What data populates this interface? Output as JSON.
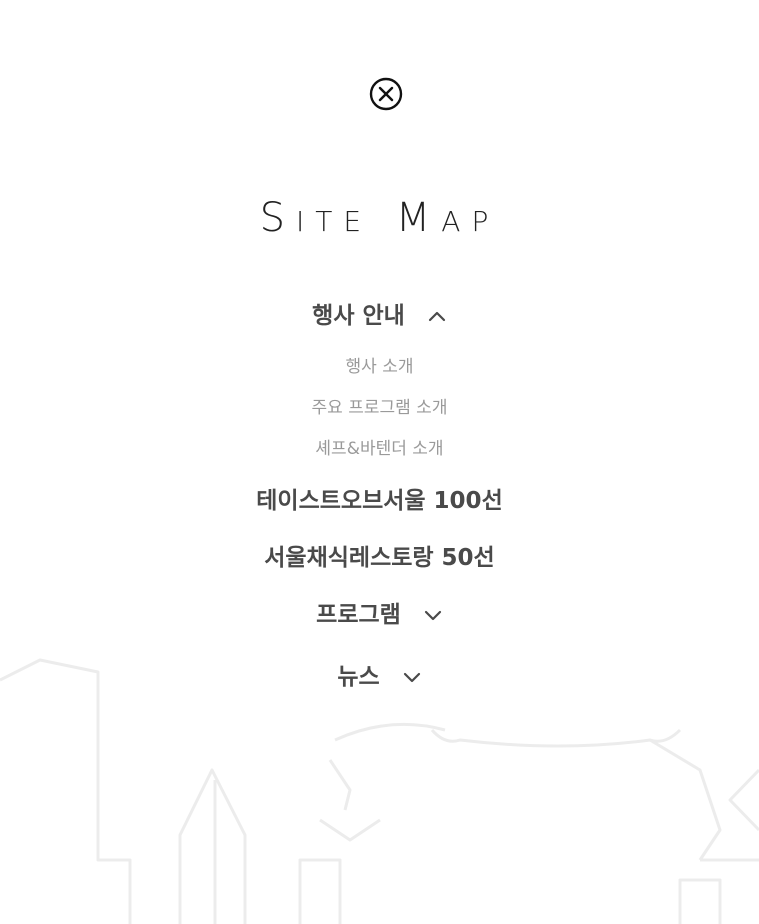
{
  "header": {
    "close_icon": "close-circle-icon",
    "title": "Site Map"
  },
  "menu": {
    "event_info": {
      "label": "행사 안내",
      "icon": "chevron-up-icon",
      "sub_items": [
        {
          "label": "행사 소개"
        },
        {
          "label": "주요 프로그램 소개"
        },
        {
          "label": "셰프&바텐더 소개"
        }
      ]
    },
    "taste_of_seoul": {
      "label": "테이스트오브서울 100선"
    },
    "vegan_restaurants": {
      "label": "서울채식레스토랑 50선"
    },
    "program": {
      "label": "프로그램",
      "icon": "chevron-down-icon"
    },
    "news": {
      "label": "뉴스",
      "icon": "chevron-down-icon"
    }
  },
  "colors": {
    "background": "#ffffff",
    "heading": "#222222",
    "menu_text": "#4a4a4a",
    "sub_text": "#9a9a9a",
    "illustration_line": "#ececec"
  }
}
